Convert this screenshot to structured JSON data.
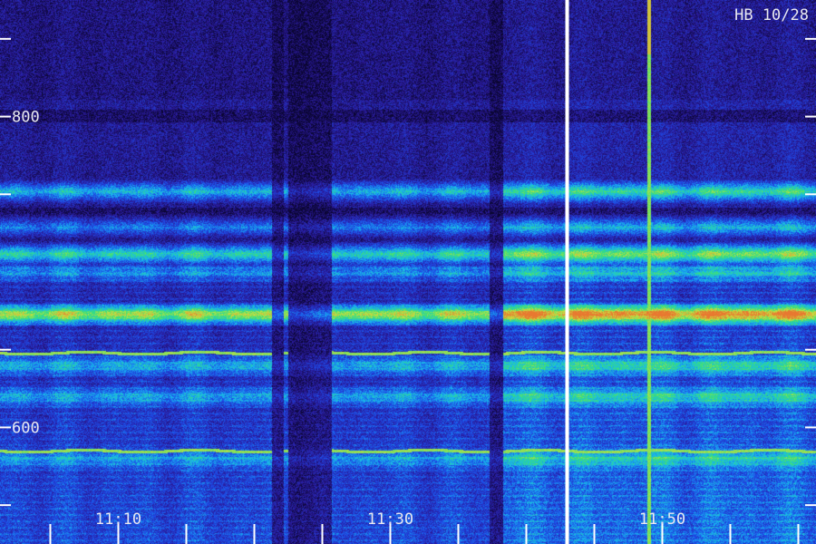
{
  "header": {
    "stamp": "HB 10/28"
  },
  "chart_data": {
    "type": "heatmap",
    "title": "",
    "xlabel": "",
    "ylabel": "",
    "x_ticks": [
      "11:10",
      "11:30",
      "11:50"
    ],
    "y_ticks": [
      800,
      600
    ],
    "time_range_minutes": [
      11.0,
      11.0
    ],
    "x_start_label_minute": 10,
    "x_label_spacing_minutes": 20,
    "ylim": [
      525,
      875
    ],
    "colormap": [
      "#0a0530",
      "#2a1a9a",
      "#1d4ce8",
      "#18b8ee",
      "#38e078",
      "#c8e040",
      "#e87830"
    ],
    "marker_time": "11:43",
    "bands": [
      {
        "freq": 752,
        "intensity": 0.55
      },
      {
        "freq": 730,
        "intensity": 0.45
      },
      {
        "freq": 712,
        "intensity": 0.68
      },
      {
        "freq": 700,
        "intensity": 0.35
      },
      {
        "freq": 673,
        "intensity": 0.92
      },
      {
        "freq": 640,
        "intensity": 0.4
      },
      {
        "freq": 620,
        "intensity": 0.35
      },
      {
        "freq": 580,
        "intensity": 0.3
      }
    ],
    "lines": [
      {
        "freq": 648,
        "color": "#30d890"
      },
      {
        "freq": 585,
        "color": "#40e070"
      }
    ],
    "spike_time": "11:49"
  }
}
